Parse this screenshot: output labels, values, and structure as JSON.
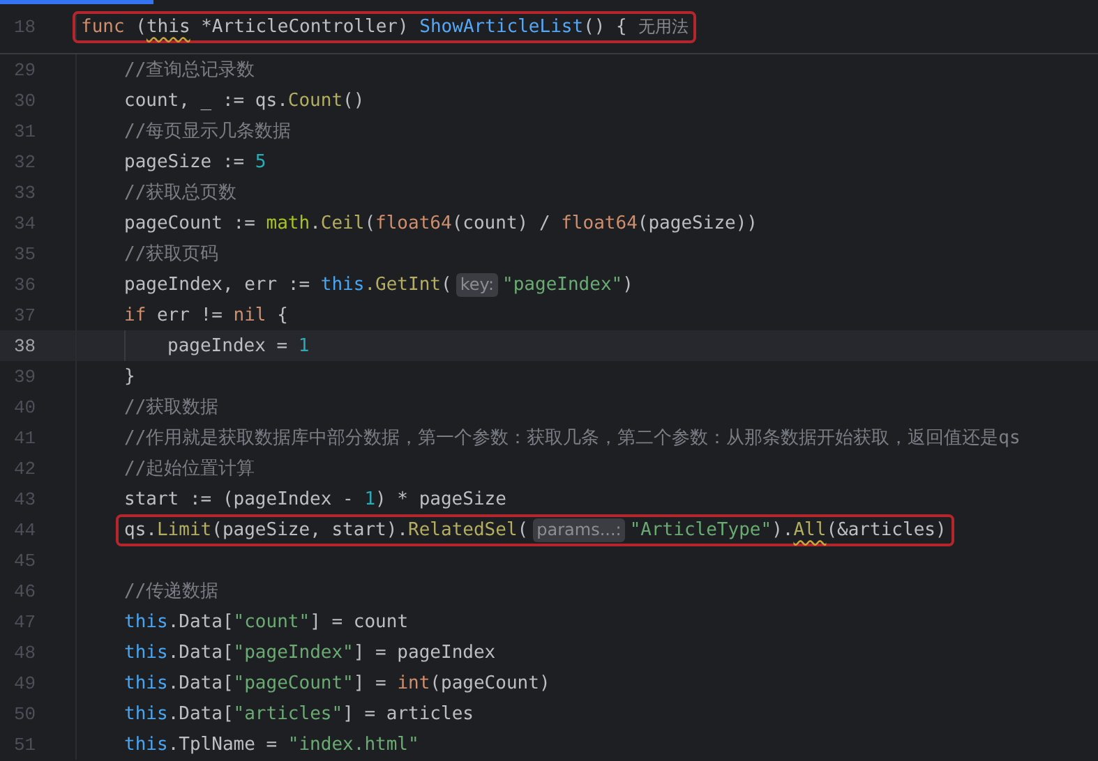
{
  "function": {
    "number": "18",
    "boxed": true,
    "current": false,
    "tokens": [
      {
        "text": "func",
        "kind": "keyword"
      },
      {
        "text": " (",
        "kind": "plain"
      },
      {
        "text": "this",
        "kind": "plain",
        "warning": true
      },
      {
        "text": " *ArticleController) ",
        "kind": "plain"
      },
      {
        "text": "ShowArticleList",
        "kind": "decl"
      },
      {
        "text": "() {",
        "kind": "plain"
      },
      {
        "text": "无用法",
        "kind": "note"
      }
    ],
    "children": [
      {
        "number": "29",
        "boxed": false,
        "current": false,
        "tokens": [
          {
            "text": "//查询总记录数",
            "kind": "comment"
          }
        ]
      },
      {
        "number": "30",
        "boxed": false,
        "current": false,
        "tokens": [
          {
            "text": "count, _ := qs.",
            "kind": "plain"
          },
          {
            "text": "Count",
            "kind": "method"
          },
          {
            "text": "()",
            "kind": "plain"
          }
        ]
      },
      {
        "number": "31",
        "boxed": false,
        "current": false,
        "tokens": [
          {
            "text": "//每页显示几条数据",
            "kind": "comment"
          }
        ]
      },
      {
        "number": "32",
        "boxed": false,
        "current": false,
        "tokens": [
          {
            "text": "pageSize := ",
            "kind": "plain"
          },
          {
            "text": "5",
            "kind": "number"
          }
        ]
      },
      {
        "number": "33",
        "boxed": false,
        "current": false,
        "tokens": [
          {
            "text": "//获取总页数",
            "kind": "comment"
          }
        ]
      },
      {
        "number": "34",
        "boxed": false,
        "current": false,
        "tokens": [
          {
            "text": "pageCount := ",
            "kind": "plain"
          },
          {
            "text": "math",
            "kind": "package"
          },
          {
            "text": ".",
            "kind": "plain"
          },
          {
            "text": "Ceil",
            "kind": "method"
          },
          {
            "text": "(",
            "kind": "plain"
          },
          {
            "text": "float64",
            "kind": "keyword"
          },
          {
            "text": "(count) / ",
            "kind": "plain"
          },
          {
            "text": "float64",
            "kind": "keyword"
          },
          {
            "text": "(pageSize))",
            "kind": "plain"
          }
        ]
      },
      {
        "number": "35",
        "boxed": false,
        "current": false,
        "tokens": [
          {
            "text": "//获取页码",
            "kind": "comment"
          }
        ]
      },
      {
        "number": "36",
        "boxed": false,
        "current": false,
        "tokens": [
          {
            "text": "pageIndex, err := ",
            "kind": "plain"
          },
          {
            "text": "this",
            "kind": "receiver"
          },
          {
            "text": ".GetInt",
            "kind": "method"
          },
          {
            "text": "(",
            "kind": "plain"
          },
          {
            "text": "key:",
            "kind": "hint"
          },
          {
            "text": "\"pageIndex\"",
            "kind": "string"
          },
          {
            "text": ")",
            "kind": "plain"
          }
        ]
      },
      {
        "number": "37",
        "boxed": false,
        "current": false,
        "tokens": [
          {
            "text": "if",
            "kind": "keyword"
          },
          {
            "text": " err != ",
            "kind": "plain"
          },
          {
            "text": "nil",
            "kind": "keyword"
          },
          {
            "text": " {",
            "kind": "plain"
          }
        ],
        "children": [
          {
            "number": "38",
            "boxed": false,
            "current": true,
            "tokens": [
              {
                "text": "pageIndex = ",
                "kind": "plain"
              },
              {
                "text": "1",
                "kind": "number"
              }
            ]
          }
        ]
      },
      {
        "number": "39",
        "boxed": false,
        "current": false,
        "tokens": [
          {
            "text": "}",
            "kind": "plain"
          }
        ]
      },
      {
        "number": "40",
        "boxed": false,
        "current": false,
        "tokens": [
          {
            "text": "//获取数据",
            "kind": "comment"
          }
        ]
      },
      {
        "number": "41",
        "boxed": false,
        "current": false,
        "tokens": [
          {
            "text": "//作用就是获取数据库中部分数据，第一个参数：获取几条，第二个参数：从那条数据开始获取，返回值还是qs",
            "kind": "comment"
          }
        ]
      },
      {
        "number": "42",
        "boxed": false,
        "current": false,
        "tokens": [
          {
            "text": "//起始位置计算",
            "kind": "comment"
          }
        ]
      },
      {
        "number": "43",
        "boxed": false,
        "current": false,
        "tokens": [
          {
            "text": "start := (pageIndex - ",
            "kind": "plain"
          },
          {
            "text": "1",
            "kind": "number"
          },
          {
            "text": ") * pageSize",
            "kind": "plain"
          }
        ]
      },
      {
        "number": "44",
        "boxed": true,
        "current": false,
        "tokens": [
          {
            "text": "qs.",
            "kind": "plain"
          },
          {
            "text": "Limit",
            "kind": "method"
          },
          {
            "text": "(pageSize, start).",
            "kind": "plain"
          },
          {
            "text": "RelatedSel",
            "kind": "method"
          },
          {
            "text": "(",
            "kind": "plain"
          },
          {
            "text": "params...:",
            "kind": "hint"
          },
          {
            "text": "\"ArticleType\"",
            "kind": "string"
          },
          {
            "text": ").",
            "kind": "plain"
          },
          {
            "text": "All",
            "kind": "method",
            "warning": true
          },
          {
            "text": "(&articles)",
            "kind": "plain"
          }
        ]
      },
      {
        "number": "45",
        "boxed": false,
        "current": false
      },
      {
        "number": "46",
        "boxed": false,
        "current": false,
        "tokens": [
          {
            "text": "//传递数据",
            "kind": "comment"
          }
        ]
      },
      {
        "number": "47",
        "boxed": false,
        "current": false,
        "tokens": [
          {
            "text": "this",
            "kind": "receiver"
          },
          {
            "text": ".Data[",
            "kind": "plain"
          },
          {
            "text": "\"count\"",
            "kind": "string"
          },
          {
            "text": "] = count",
            "kind": "plain"
          }
        ]
      },
      {
        "number": "48",
        "boxed": false,
        "current": false,
        "tokens": [
          {
            "text": "this",
            "kind": "receiver"
          },
          {
            "text": ".Data[",
            "kind": "plain"
          },
          {
            "text": "\"pageIndex\"",
            "kind": "string"
          },
          {
            "text": "] = pageIndex",
            "kind": "plain"
          }
        ]
      },
      {
        "number": "49",
        "boxed": false,
        "current": false,
        "tokens": [
          {
            "text": "this",
            "kind": "receiver"
          },
          {
            "text": ".Data[",
            "kind": "plain"
          },
          {
            "text": "\"pageCount\"",
            "kind": "string"
          },
          {
            "text": "] = ",
            "kind": "plain"
          },
          {
            "text": "int",
            "kind": "keyword"
          },
          {
            "text": "(pageCount)",
            "kind": "plain"
          }
        ]
      },
      {
        "number": "50",
        "boxed": false,
        "current": false,
        "tokens": [
          {
            "text": "this",
            "kind": "receiver"
          },
          {
            "text": ".Data[",
            "kind": "plain"
          },
          {
            "text": "\"articles\"",
            "kind": "string"
          },
          {
            "text": "] = articles",
            "kind": "plain"
          }
        ]
      },
      {
        "number": "51",
        "boxed": false,
        "current": false,
        "tokens": [
          {
            "text": "this",
            "kind": "receiver"
          },
          {
            "text": ".TplName = ",
            "kind": "plain"
          },
          {
            "text": "\"index.html\"",
            "kind": "string"
          }
        ]
      }
    ]
  }
}
